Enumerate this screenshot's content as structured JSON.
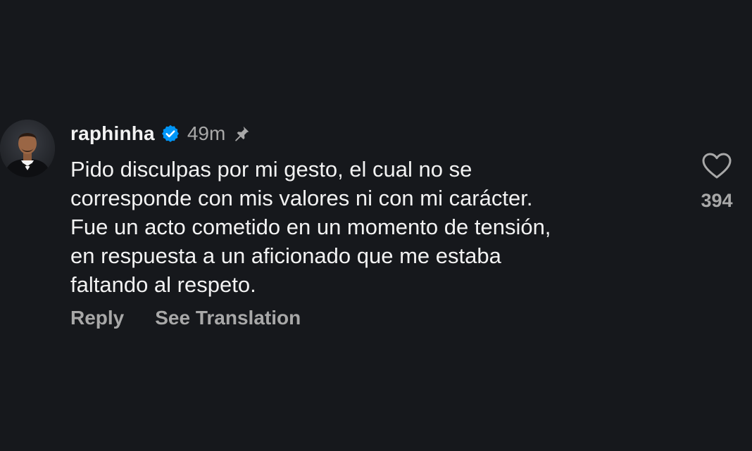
{
  "comment": {
    "username": "raphinha",
    "verified": true,
    "time": "49m",
    "pinned": true,
    "text_lines": [
      "Pido disculpas por mi gesto, el cual no se",
      "corresponde con mis valores ni con mi carácter.",
      "Fue un acto cometido en un momento de tensión,",
      "en respuesta a un aficionado que me estaba",
      "faltando al respeto."
    ],
    "actions": {
      "reply": "Reply",
      "see_translation": "See Translation"
    },
    "likes": "394"
  },
  "colors": {
    "background": "#16181c",
    "text_primary": "#f2f2f2",
    "text_secondary": "#a8a8a8",
    "verified_blue": "#0095f6"
  },
  "icons": {
    "verified": "verified-badge-icon",
    "pin": "pin-icon",
    "like": "heart-icon"
  }
}
